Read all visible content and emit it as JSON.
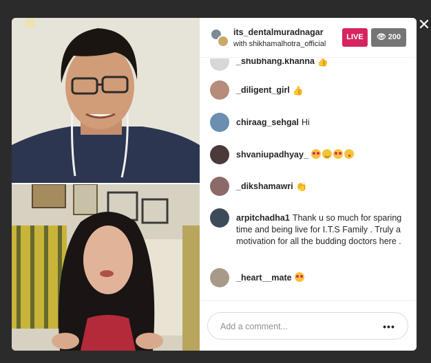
{
  "header": {
    "username": "its_dentalmuradnagar",
    "with_text": "with shikhamalhotra_official",
    "live_label": "LIVE",
    "viewer_count": "200"
  },
  "comments": [
    {
      "user": "_shubhang.khanna",
      "text": "",
      "emoji": [
        "thumbs-up"
      ]
    },
    {
      "user": "_diligent_girl",
      "text": "",
      "emoji": [
        "thumbs-up"
      ]
    },
    {
      "user": "chiraag_sehgal",
      "text": "Hi",
      "emoji": []
    },
    {
      "user": "shvaniupadhyay_",
      "text": "",
      "emoji": [
        "heart-eyes",
        "blush",
        "heart-eyes",
        "kiss"
      ]
    },
    {
      "user": "_dikshamawri",
      "text": "",
      "emoji": [
        "clap"
      ]
    },
    {
      "user": "arpitchadha1",
      "text": "Thank u so much for sparing time and being live for I.T.S Family . Truly a motivation for all the budding doctors here .",
      "emoji": []
    },
    {
      "user": "_heart__mate",
      "text": "",
      "emoji": [
        "heart-eyes"
      ]
    }
  ],
  "footer": {
    "comment_placeholder": "Add a comment...",
    "more_label": "•••"
  },
  "colors": {
    "live": "#d6245f",
    "viewers": "#757575",
    "backdrop": "#2b2b2b"
  }
}
